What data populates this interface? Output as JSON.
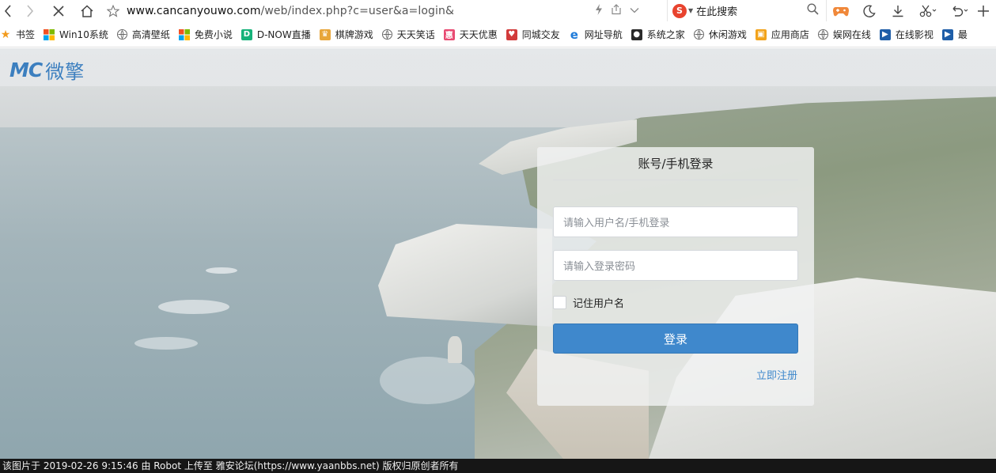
{
  "toolbar": {
    "back_icon": "chevron-left-icon",
    "forward_icon": "chevron-right-icon",
    "stop_icon": "close-icon",
    "home_icon": "home-icon",
    "bookmark_icon": "star-icon",
    "url_host": "www.cancanyouwo.com",
    "url_path": "/web/index.php?c=user&a=login&",
    "search": {
      "engine_badge": "S",
      "text": "在此搜索"
    },
    "right_icons": [
      "gamepad-icon",
      "moon-icon",
      "download-icon",
      "scissors-icon",
      "undo-icon",
      "plus-icon"
    ]
  },
  "bookmarks": [
    {
      "label": "书签",
      "icon": "star-icon",
      "color": "#f29b1d"
    },
    {
      "label": "Win10系统",
      "icon": "windows-icon",
      "color": "#2f7cd3"
    },
    {
      "label": "高清壁纸",
      "icon": "globe-icon",
      "color": "#666666"
    },
    {
      "label": "免费小说",
      "icon": "windows-icon",
      "color": "#e7452f"
    },
    {
      "label": "D-NOW直播",
      "icon": "d-now-icon",
      "color": "#16b27a"
    },
    {
      "label": "棋牌游戏",
      "icon": "chess-icon",
      "color": "#e8a63a"
    },
    {
      "label": "天天笑话",
      "icon": "globe-icon",
      "color": "#666666"
    },
    {
      "label": "天天优惠",
      "icon": "coupon-icon",
      "color": "#e84a72"
    },
    {
      "label": "同城交友",
      "icon": "heart-icon",
      "color": "#d23b3b"
    },
    {
      "label": "网址导航",
      "icon": "e-icon",
      "color": "#1d7ad9"
    },
    {
      "label": "系统之家",
      "icon": "sys-icon",
      "color": "#2a2a2a"
    },
    {
      "label": "休闲游戏",
      "icon": "globe-icon",
      "color": "#666666"
    },
    {
      "label": "应用商店",
      "icon": "store-icon",
      "color": "#f2a31b"
    },
    {
      "label": "娱网在线",
      "icon": "globe-icon",
      "color": "#666666"
    },
    {
      "label": "在线影视",
      "icon": "film-icon",
      "color": "#1f5ea8"
    },
    {
      "label": "最",
      "icon": "film-icon",
      "color": "#1f5ea8"
    }
  ],
  "logo": {
    "mark": "MC",
    "text": "微擎"
  },
  "login": {
    "title": "账号/手机登录",
    "username_placeholder": "请输入用户名/手机登录",
    "password_placeholder": "请输入登录密码",
    "remember_label": "记住用户名",
    "submit_label": "登录",
    "register_label": "立即注册"
  },
  "status_bar": {
    "text": "该图片于 2019-02-26 9:15:46 由 Robot 上传至 雅安论坛(https://www.yaanbbs.net) 版权归原创者所有"
  },
  "colors": {
    "brand": "#3c7fbf",
    "button": "#3f88cc",
    "link": "#3f88cc"
  }
}
